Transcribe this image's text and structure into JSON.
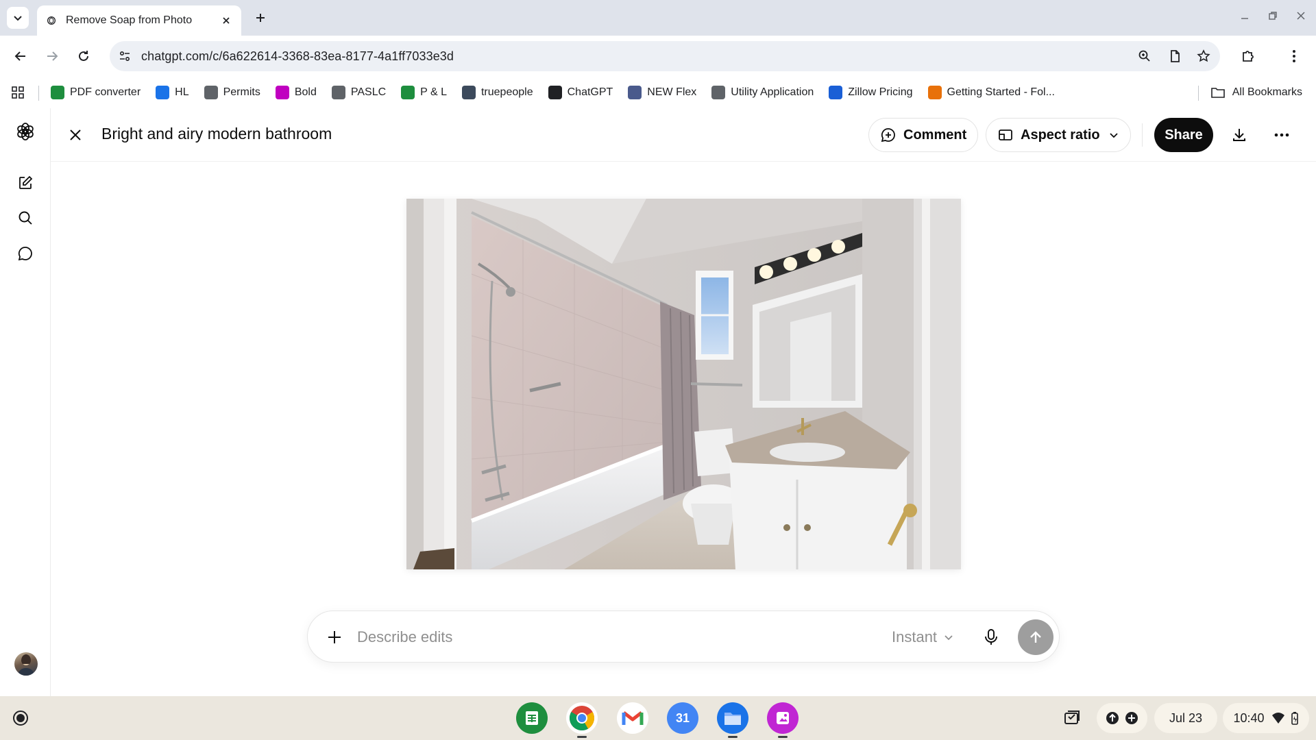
{
  "browser": {
    "tab_title": "Remove Soap from Photo",
    "url": "chatgpt.com/c/6a622614-3368-83ea-8177-4a1ff7033e3d",
    "bookmarks": [
      {
        "label": "PDF converter",
        "icon": "pdf-converter-icon",
        "color": "#1e8e3e"
      },
      {
        "label": "HL",
        "icon": "hl-icon",
        "color": "#1a73e8"
      },
      {
        "label": "Permits",
        "icon": "permits-icon",
        "color": "#5f6368"
      },
      {
        "label": "Bold",
        "icon": "bold-icon",
        "color": "#c000c0"
      },
      {
        "label": "PASLC",
        "icon": "paslc-icon",
        "color": "#5f6368"
      },
      {
        "label": "P & L",
        "icon": "p-and-l-icon",
        "color": "#1e8e3e"
      },
      {
        "label": "truepeople",
        "icon": "truepeople-icon",
        "color": "#3c4a5c"
      },
      {
        "label": "ChatGPT",
        "icon": "chatgpt-icon",
        "color": "#202124"
      },
      {
        "label": "NEW Flex",
        "icon": "new-flex-icon",
        "color": "#4a5a8c"
      },
      {
        "label": "Utility Application",
        "icon": "utility-application-icon",
        "color": "#5f6368"
      },
      {
        "label": "Zillow Pricing",
        "icon": "zillow-icon",
        "color": "#1a5fd6"
      },
      {
        "label": "Getting Started - Fol...",
        "icon": "getting-started-icon",
        "color": "#e8710a"
      }
    ],
    "all_bookmarks_label": "All Bookmarks"
  },
  "viewer": {
    "title": "Bright and airy modern bathroom",
    "comment_label": "Comment",
    "aspect_ratio_label": "Aspect ratio",
    "share_label": "Share"
  },
  "composer": {
    "placeholder": "Describe edits",
    "model_label": "Instant"
  },
  "shelf": {
    "apps": [
      "sheets-icon",
      "chrome-icon",
      "gmail-icon",
      "calendar-icon",
      "files-icon",
      "gallery-icon"
    ],
    "calendar_day": "31",
    "date": "Jul 23",
    "time": "10:40"
  },
  "colors": {
    "share_button": "#0d0d0d",
    "send_button": "#9e9e9e",
    "tabstrip": "#dfe3eb",
    "shelf": "#ebe7de"
  }
}
